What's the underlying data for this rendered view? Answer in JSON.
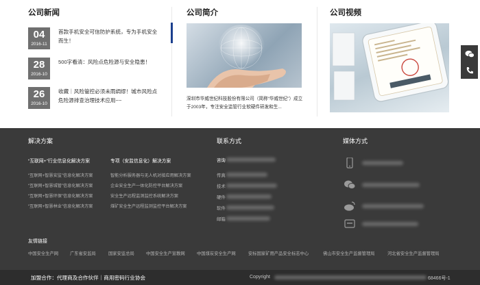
{
  "news": {
    "title": "公司新闻",
    "items": [
      {
        "day": "04",
        "ym": "2016-11",
        "text": "首款手机安全可信防护系统，专为手机安全而生！"
      },
      {
        "day": "28",
        "ym": "2016-10",
        "text": "500字看清：风险点危险源与安全隐患！"
      },
      {
        "day": "26",
        "ym": "2016-10",
        "text": "收藏｜风险管控必须未雨绸缪！城市风险点危险源排查治理技术应用~~"
      }
    ]
  },
  "intro": {
    "title": "公司简介",
    "text": "深圳市华威世纪科技股份有限公司（简称“华威世纪”）成立于2003年，专注安全监管行业软硬件研发和生..."
  },
  "video": {
    "title": "公司视频"
  },
  "side": {
    "wechat_icon": "wechat-icon",
    "phone_icon": "phone-icon"
  },
  "footer": {
    "solutions": {
      "title": "解决方案",
      "col1_title": "“互联网+”行业信息化解决方案",
      "col1": [
        "“互联网+智慧安监”信息化解决方案",
        "“互联网+智慧城管”信息化解决方案",
        "“互联网+智慧环保”信息化解决方案",
        "“互联网+智慧林业”信息化解决方案"
      ],
      "col2_title": "专项（安监信息化）解决方案",
      "col2": [
        "智能分析服务器与无人机对接应用解决方案",
        "企业安全生产一体化防控平台解决方案",
        "安全生产远程监测监控系统解决方案",
        "煤矿安全生产远程监测监控平台解决方案"
      ]
    },
    "contact": {
      "title": "联系方式",
      "labels": [
        "咨询",
        "传真",
        "技术",
        "硬件",
        "软件",
        "邮箱"
      ]
    },
    "media": {
      "title": "媒体方式"
    },
    "friends": {
      "title": "友情链接",
      "links": [
        "中国安全生产网",
        "广东省安监局",
        "国家安监总局",
        "中国安全生产宣教网",
        "中国煤炭安全生产网",
        "安标国家矿用产品安全标志中心",
        "佛山市安全生产监督管理局",
        "河北省安全生产监督管理局"
      ]
    },
    "bottom": {
      "cooperation": "加盟合作：代理商及合作伙伴｜商用密码行业协会",
      "copyright": "Copyright",
      "record_suffix": "68466号-1"
    }
  }
}
